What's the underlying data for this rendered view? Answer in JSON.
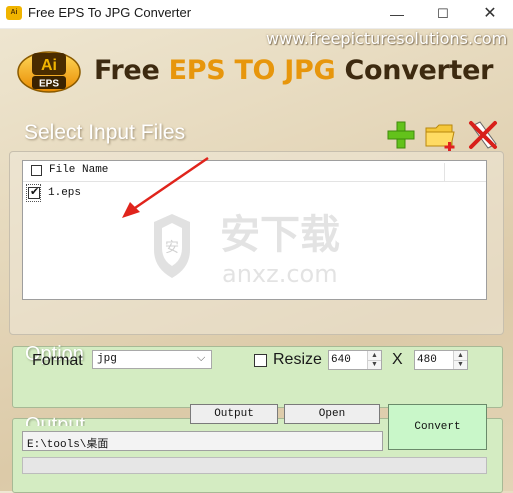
{
  "window": {
    "title": "Free EPS To JPG Converter",
    "minimize_glyph": "—",
    "maximize_glyph": "☐",
    "close_glyph": "✕",
    "icon": "app-icon"
  },
  "header": {
    "url": "www.freepicturesolutions.com",
    "logo_text_top": "Ai",
    "logo_text_bottom": "EPS",
    "title_part1": "Free ",
    "title_part2": "EPS TO JPG",
    "title_part3": " Converter"
  },
  "input_section": {
    "heading": "Select Input Files",
    "tools": [
      {
        "icon": "add-icon"
      },
      {
        "icon": "folder-add-icon"
      },
      {
        "icon": "remove-icon"
      }
    ],
    "list_header": "File Name",
    "files": [
      {
        "name": "1.eps",
        "checked": true
      }
    ]
  },
  "watermark": {
    "cn_text": "安下载",
    "url": "anxz.com"
  },
  "option_section": {
    "heading": "Option",
    "format_label": "Format",
    "format_value": "jpg",
    "resize_label": "Resize",
    "resize_checked": false,
    "width": "640",
    "x_label": "X",
    "height": "480"
  },
  "output_section": {
    "heading": "Output",
    "output_button": "Output",
    "open_button": "Open",
    "convert_button": "Convert",
    "path": "E:\\tools\\桌面",
    "progress": 0
  },
  "colors": {
    "accent": "#e7960c",
    "panel": "#d4ecc2",
    "convert": "#c9f7c9",
    "arrow": "#e0241c"
  }
}
